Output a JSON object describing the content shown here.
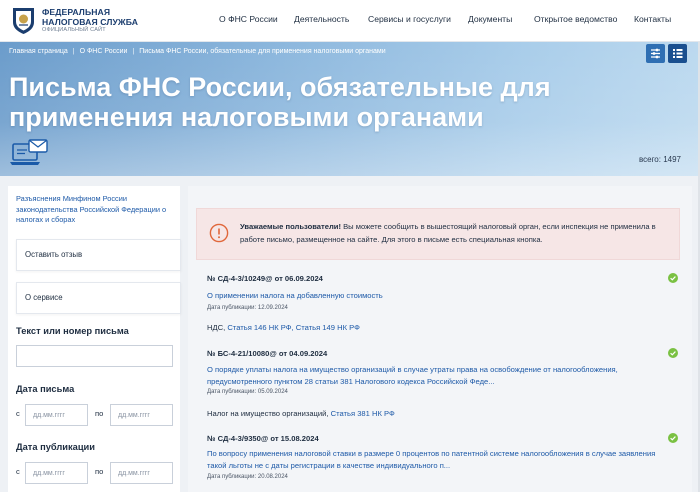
{
  "header": {
    "logo": {
      "line1": "ФЕДЕРАЛЬНАЯ",
      "line2": "НАЛОГОВАЯ СЛУЖБА",
      "line3": "ОФИЦИАЛЬНЫЙ САЙТ"
    },
    "nav": [
      "О ФНС России",
      "Деятельность",
      "Сервисы и госуслуги",
      "Документы",
      "Открытое ведомство",
      "Контакты"
    ]
  },
  "breadcrumb": [
    "Главная страница",
    "О ФНС России",
    "Письма ФНС России, обязательные для применения налоговыми органами"
  ],
  "hero": {
    "title": "Письма ФНС России, обязательные для применения налоговыми органами",
    "total": "всего: 1497"
  },
  "sidebar": {
    "link": "Разъяснения Минфином России законодательства Российской Федерации о налогах и сборах",
    "feedback": "Оставить отзыв",
    "about": "О сервисе",
    "search_heading": "Текст или номер письма",
    "search_placeholder": "",
    "letter_date_heading": "Дата письма",
    "pub_date_heading": "Дата публикации",
    "from_label": "с",
    "to_label": "по",
    "date_placeholder": "дд.мм.гггг"
  },
  "notice": {
    "bold": "Уважаемые пользователи!",
    "text": " Вы можете сообщить в вышестоящий налоговый орган, если инспекция не применила в работе письмо, размещенное на сайте. Для этого в письме есть специальная кнопка."
  },
  "letters": [
    {
      "number": "№ СД-4-3/10249@ от 06.09.2024",
      "title": "О применении налога на добавленную стоимость",
      "pub": "Дата публикации: 12.09.2024",
      "tag_prefix": "НДС, ",
      "tags": [
        "Статья 146 НК РФ,",
        "Статья 149 НК РФ"
      ]
    },
    {
      "number": "№ БС-4-21/10080@ от 04.09.2024",
      "title": "О порядке уплаты налога на имущество организаций в случае утраты права на освобождение от налогообложения, предусмотренного пунктом 28 статьи 381 Налогового кодекса Российской Феде...",
      "pub": "Дата публикации: 05.09.2024",
      "tag_prefix": "Налог на имущество организаций, ",
      "tags": [
        "Статья 381 НК РФ"
      ]
    },
    {
      "number": "№ СД-4-3/9350@ от 15.08.2024",
      "title": "По вопросу применения налоговой ставки в размере 0 процентов по патентной системе налогообложения в случае заявления такой льготы не с даты регистрации в качестве индивидуального п...",
      "pub": "Дата публикации: 20.08.2024",
      "tag_prefix": "",
      "tags": []
    }
  ],
  "colors": {
    "brand": "#1b3d6e",
    "link": "#1e5aa8",
    "check": "#7ac143",
    "notice_bg": "#f6e6e6",
    "notice_icon": "#e0673b"
  }
}
